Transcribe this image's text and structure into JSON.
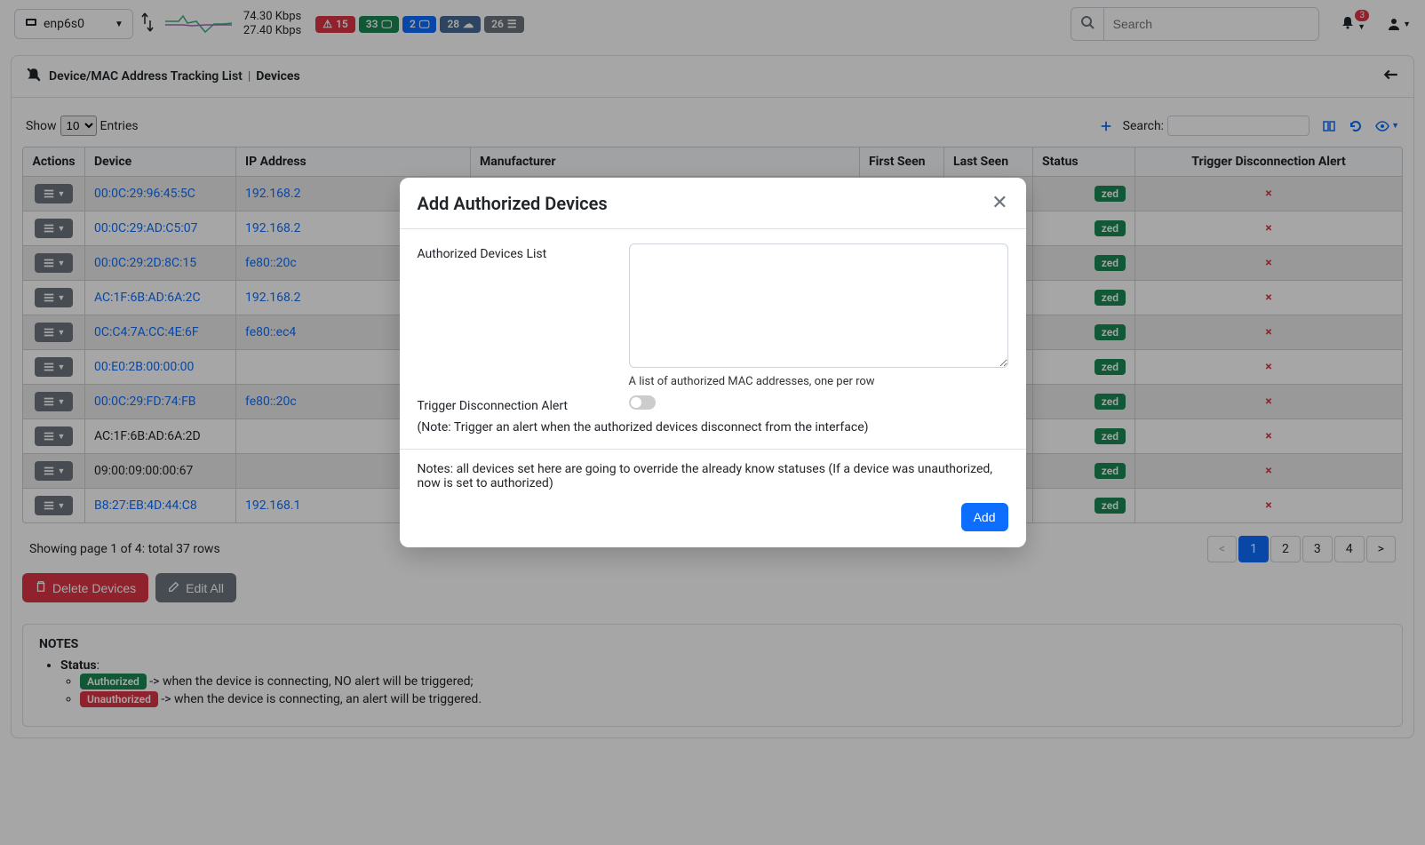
{
  "topbar": {
    "interface": "enp6s0",
    "speed_down": "74.30 Kbps",
    "speed_up": "27.40 Kbps",
    "badges": {
      "alert": "15",
      "green": "33",
      "blue": "2",
      "bluegrey": "28",
      "grey": "26"
    },
    "search_placeholder": "Search",
    "notif_count": "3"
  },
  "breadcrumb": {
    "title": "Device/MAC Address Tracking List",
    "sep": "|",
    "current": "Devices"
  },
  "table_ctrl": {
    "show_label_pre": "Show",
    "show_value": "10",
    "show_label_post": "Entries",
    "search_label": "Search:"
  },
  "columns": {
    "actions": "Actions",
    "device": "Device",
    "ip": "IP Address",
    "manufacturer": "Manufacturer",
    "first_seen": "First Seen",
    "last_seen": "Last Seen",
    "status": "Status",
    "trigger": "Trigger Disconnection Alert"
  },
  "rows": [
    {
      "device": "00:0C:29:96:45:5C",
      "device_link": true,
      "ip": "192.168.2",
      "ip_link": true,
      "status": "zed",
      "trigger": "×"
    },
    {
      "device": "00:0C:29:AD:C5:07",
      "device_link": true,
      "ip": "192.168.2",
      "ip_link": true,
      "status": "zed",
      "trigger": "×"
    },
    {
      "device": "00:0C:29:2D:8C:15",
      "device_link": true,
      "ip": "fe80::20c",
      "ip_link": true,
      "status": "zed",
      "trigger": "×"
    },
    {
      "device": "AC:1F:6B:AD:6A:2C",
      "device_link": true,
      "ip": "192.168.2",
      "ip_link": true,
      "status": "zed",
      "trigger": "×"
    },
    {
      "device": "0C:C4:7A:CC:4E:6F",
      "device_link": true,
      "ip": "fe80::ec4",
      "ip_link": true,
      "status": "zed",
      "trigger": "×"
    },
    {
      "device": "00:E0:2B:00:00:00",
      "device_link": true,
      "ip": "",
      "ip_link": false,
      "status": "zed",
      "trigger": "×"
    },
    {
      "device": "00:0C:29:FD:74:FB",
      "device_link": true,
      "ip": "fe80::20c",
      "ip_link": true,
      "status": "zed",
      "trigger": "×"
    },
    {
      "device": "AC:1F:6B:AD:6A:2D",
      "device_link": false,
      "ip": "",
      "ip_link": false,
      "status": "zed",
      "trigger": "×"
    },
    {
      "device": "09:00:09:00:00:67",
      "device_link": false,
      "ip": "",
      "ip_link": false,
      "status": "zed",
      "trigger": "×"
    },
    {
      "device": "B8:27:EB:4D:44:C8",
      "device_link": true,
      "ip": "192.168.1",
      "ip_link": true,
      "status": "zed",
      "trigger": "×"
    }
  ],
  "footer": {
    "summary": "Showing page 1 of 4: total 37 rows",
    "pages": [
      "<",
      "1",
      "2",
      "3",
      "4",
      ">"
    ],
    "active_page": "1"
  },
  "buttons": {
    "delete": "Delete Devices",
    "edit_all": "Edit All"
  },
  "notes": {
    "heading": "NOTES",
    "status_label": "Status",
    "authorized_pill": "Authorized",
    "authorized_text": " -> when the device is connecting, NO alert will be triggered;",
    "unauthorized_pill": "Unauthorized",
    "unauthorized_text": " -> when the device is connecting, an alert will be triggered."
  },
  "modal": {
    "title": "Add Authorized Devices",
    "field_list_label": "Authorized Devices List",
    "field_list_help": "A list of authorized MAC addresses, one per row",
    "field_trigger_label": "Trigger Disconnection Alert",
    "trigger_note": "(Note: Trigger an alert when the authorized devices disconnect from the interface)",
    "footer_note": "Notes: all devices set here are going to override the already know statuses (If a device was unauthorized, now is set to authorized)",
    "add_btn": "Add"
  }
}
